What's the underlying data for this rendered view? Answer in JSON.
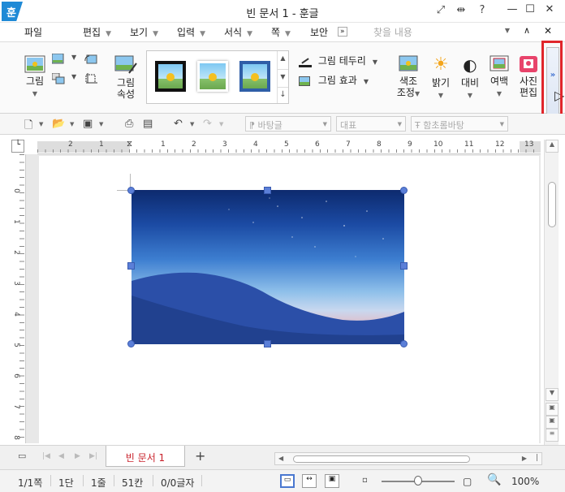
{
  "window": {
    "title": "빈 문서 1 - 훈글",
    "logo_char": "훈"
  },
  "menubar": {
    "items": [
      {
        "label": "파일",
        "has_arrow": false
      },
      {
        "label": "편집",
        "has_arrow": true
      },
      {
        "label": "보기",
        "has_arrow": true
      },
      {
        "label": "입력",
        "has_arrow": true
      },
      {
        "label": "서식",
        "has_arrow": true
      },
      {
        "label": "쪽",
        "has_arrow": true
      },
      {
        "label": "보안",
        "has_arrow": false
      }
    ],
    "search_placeholder": "찾을 내용"
  },
  "ribbon": {
    "picture_label": "그림",
    "picture_props_line1": "그림",
    "picture_props_line2": "속성",
    "border_label": "그림 테두리",
    "effect_label": "그림 효과",
    "color_adjust_line1": "색조",
    "color_adjust_line2": "조정",
    "brightness_label": "밝기",
    "contrast_label": "대비",
    "margin_label": "여백",
    "photo_edit_line1": "사진",
    "photo_edit_line2": "편집",
    "expand_icon": "»"
  },
  "toolbar": {
    "style_combo": "바탕글",
    "para_combo": "대표",
    "font_combo": "함초롬바탕"
  },
  "ruler": {
    "h_numbers": [
      "2",
      "1",
      "",
      "1",
      "2",
      "3",
      "4",
      "5",
      "6",
      "7",
      "8",
      "9",
      "10",
      "11",
      "12",
      "13"
    ],
    "v_numbers": [
      "0",
      "1",
      "2",
      "3",
      "4",
      "5",
      "6",
      "7",
      "8"
    ]
  },
  "tabs": {
    "doc_tab_label": "빈 문서 1",
    "add_tab": "+"
  },
  "status": {
    "page": "1/1쪽",
    "column": "1단",
    "line": "1줄",
    "char": "51칸",
    "count": "0/0글자",
    "zoom": "100%"
  },
  "colors": {
    "accent": "#1f8ad6",
    "highlight_box": "#e0262b",
    "handle": "#5b7fd8",
    "tab_text": "#c8202a"
  },
  "icons": [
    "search-icon",
    "gear-icon",
    "zoom-icon"
  ]
}
